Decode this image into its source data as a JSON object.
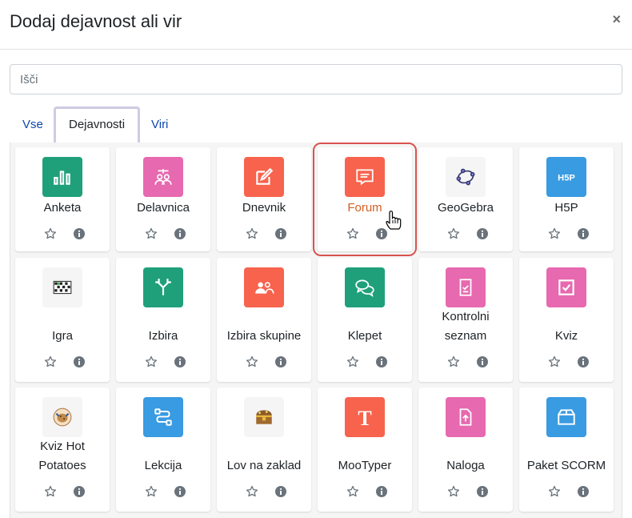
{
  "modal": {
    "title": "Dodaj dejavnost ali vir",
    "close_label": "×"
  },
  "search": {
    "placeholder": "Išči",
    "value": ""
  },
  "tabs": [
    {
      "label": "Vse",
      "active": false
    },
    {
      "label": "Dejavnosti",
      "active": true
    },
    {
      "label": "Viri",
      "active": false
    }
  ],
  "colors": {
    "green": "#1fa07a",
    "pink": "#e769b0",
    "orange": "#f7634d",
    "blue": "#399be2",
    "gray": "#f5f5f5",
    "hover_text": "#d25f21",
    "highlight_border": "#d9534f"
  },
  "activities": [
    {
      "label": "Anketa",
      "icon": "bar-chart-icon",
      "color": "green"
    },
    {
      "label": "Delavnica",
      "icon": "workshop-icon",
      "color": "pink"
    },
    {
      "label": "Dnevnik",
      "icon": "journal-edit-icon",
      "color": "orange"
    },
    {
      "label": "Forum",
      "icon": "forum-icon",
      "color": "orange",
      "highlighted": true
    },
    {
      "label": "GeoGebra",
      "icon": "geogebra-icon",
      "color": "gray"
    },
    {
      "label": "H5P",
      "icon": "h5p-icon",
      "color": "blue"
    },
    {
      "label": "Igra",
      "icon": "crossword-icon",
      "color": "gray"
    },
    {
      "label": "Izbira",
      "icon": "choice-arrows-icon",
      "color": "green"
    },
    {
      "label": "Izbira skupine",
      "icon": "group-choice-icon",
      "color": "orange"
    },
    {
      "label": "Klepet",
      "icon": "chat-icon",
      "color": "green"
    },
    {
      "label": "Kontrolni\nseznam",
      "icon": "checklist-icon",
      "color": "pink"
    },
    {
      "label": "Kviz",
      "icon": "quiz-check-icon",
      "color": "pink"
    },
    {
      "label": "Kviz Hot\nPotatoes",
      "icon": "hot-potatoes-icon",
      "color": "gray"
    },
    {
      "label": "Lekcija",
      "icon": "lesson-icon",
      "color": "blue"
    },
    {
      "label": "Lov na zaklad",
      "icon": "treasure-chest-icon",
      "color": "gray"
    },
    {
      "label": "MooTyper",
      "icon": "mootyper-icon",
      "color": "orange"
    },
    {
      "label": "Naloga",
      "icon": "assignment-upload-icon",
      "color": "pink"
    },
    {
      "label": "Paket SCORM",
      "icon": "scorm-package-icon",
      "color": "blue"
    }
  ]
}
